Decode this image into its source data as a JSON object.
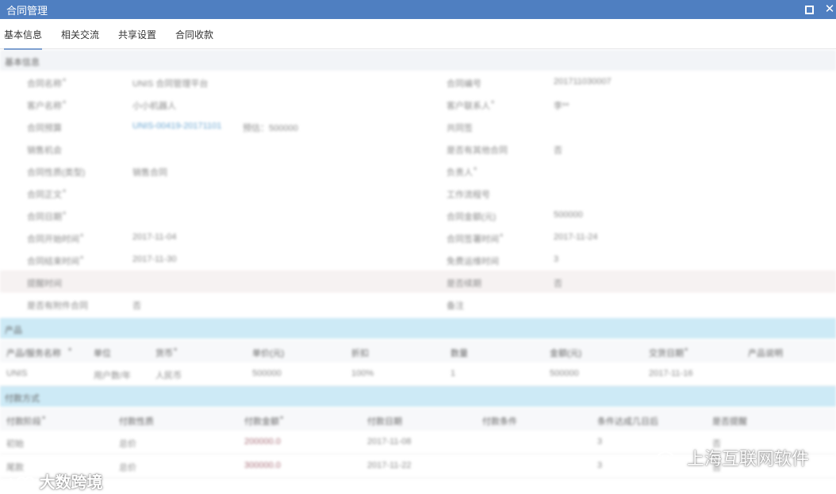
{
  "window": {
    "title": "合同管理",
    "maximize_icon": "maximize-icon",
    "close_icon": "close-icon",
    "accent": "#4f7fc1"
  },
  "tabs": [
    {
      "label": "基本信息",
      "active": true
    },
    {
      "label": "相关交流",
      "active": false
    },
    {
      "label": "共享设置",
      "active": false
    },
    {
      "label": "合同收款",
      "active": false
    }
  ],
  "basic": {
    "header": "基本信息",
    "left": [
      {
        "label": "合同名称",
        "required": true,
        "value": "UNIS 合同管理平台",
        "link": false
      },
      {
        "label": "客户名称",
        "required": true,
        "value": "小小机器人",
        "link": false
      },
      {
        "label": "合同预算",
        "required": false,
        "value": "UNIS-00419-20171101",
        "extra": "预估：500000",
        "link": true
      },
      {
        "label": "销售机会",
        "required": false,
        "value": "",
        "link": false
      },
      {
        "label": "合同性质(类型)",
        "required": false,
        "value": "销售合同",
        "link": false
      },
      {
        "label": "合同正文",
        "required": true,
        "value": "",
        "link": false
      },
      {
        "label": "合同日期",
        "required": true,
        "value": "",
        "link": false
      },
      {
        "label": "合同开始时间",
        "required": true,
        "value": "2017-11-04",
        "link": false
      },
      {
        "label": "合同结束时间",
        "required": true,
        "value": "2017-11-30",
        "link": false
      },
      {
        "label": "提醒时间",
        "required": false,
        "value": "",
        "link": false
      },
      {
        "label": "是否有附件合同",
        "required": false,
        "value": "否",
        "link": false
      }
    ],
    "right": [
      {
        "label": "合同编号",
        "required": false,
        "value": "201711030007"
      },
      {
        "label": "客户联系人",
        "required": true,
        "value": "李**"
      },
      {
        "label": "共同签",
        "required": false,
        "value": ""
      },
      {
        "label": "是否有其他合同",
        "required": false,
        "value": "否"
      },
      {
        "label": "负责人",
        "required": true,
        "value": ""
      },
      {
        "label": "工作流程号",
        "required": false,
        "value": ""
      },
      {
        "label": "合同金额(元)",
        "required": false,
        "value": "500000"
      },
      {
        "label": "合同签署时间",
        "required": true,
        "value": "2017-11-24"
      },
      {
        "label": "免费运维时间",
        "required": false,
        "value": "3"
      },
      {
        "label": "是否续期",
        "required": false,
        "value": "否"
      },
      {
        "label": "备注",
        "required": false,
        "value": ""
      }
    ]
  },
  "products": {
    "header": "产品",
    "columns": [
      {
        "label": "产品/服务名称",
        "required": true
      },
      {
        "label": "单位",
        "required": false
      },
      {
        "label": "货币",
        "required": true
      },
      {
        "label": "单价(元)",
        "required": false
      },
      {
        "label": "折扣",
        "required": false
      },
      {
        "label": "数量",
        "required": false
      },
      {
        "label": "金额(元)",
        "required": false
      },
      {
        "label": "交货日期",
        "required": true
      },
      {
        "label": "产品说明",
        "required": false
      }
    ],
    "rows": [
      [
        "UNIS",
        "用户数/年",
        "人民币",
        "500000",
        "100%",
        "1",
        "500000",
        "2017-11-16",
        ""
      ]
    ]
  },
  "payment": {
    "header": "付款方式",
    "columns": [
      {
        "label": "付款阶段",
        "required": true
      },
      {
        "label": "付款性质",
        "required": false
      },
      {
        "label": "付款金额",
        "required": true
      },
      {
        "label": "付款日期",
        "required": false
      },
      {
        "label": "付款条件",
        "required": false
      },
      {
        "label": "条件达成几日后",
        "required": false
      },
      {
        "label": "是否提醒",
        "required": false
      }
    ],
    "rows": [
      [
        "初始",
        "总价",
        "200000.0",
        "2017-11-08",
        "",
        "3",
        "否"
      ],
      [
        "尾款",
        "总价",
        "300000.0",
        "2017-11-22",
        "",
        "3",
        "否"
      ]
    ]
  },
  "watermarks": {
    "left": "大数跨境",
    "left_icon": "dashuju-logo-icon",
    "right": "上海互联网软件",
    "right_icon": "wechat-icon"
  }
}
